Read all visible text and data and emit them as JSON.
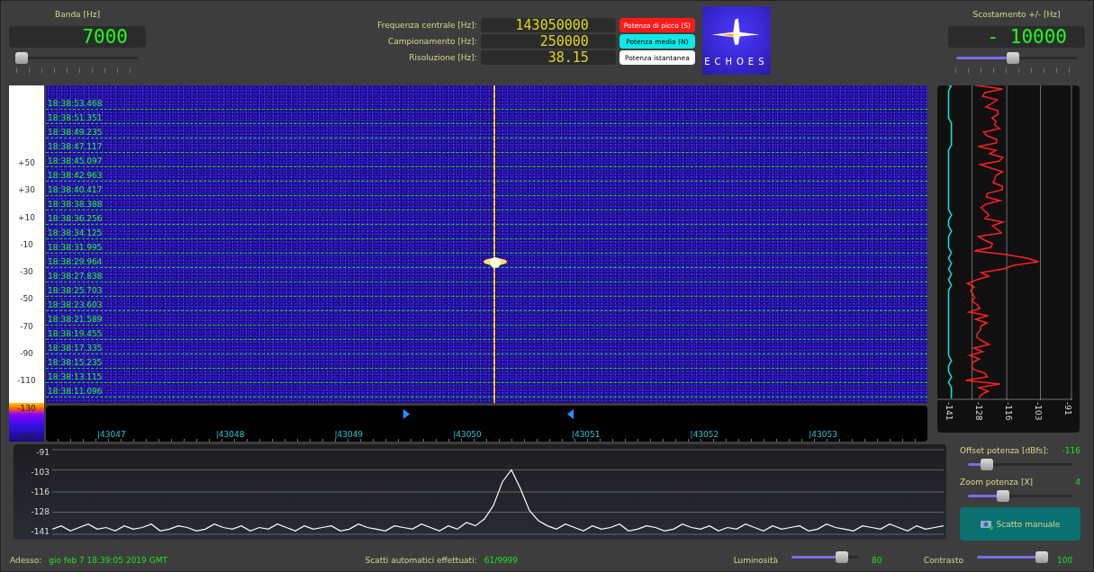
{
  "band": {
    "label": "Banda [Hz]",
    "value": "7000",
    "level": 0.04
  },
  "center": {
    "rows": [
      {
        "label": "Frequenza centrale [Hz]:",
        "value": "143050000"
      },
      {
        "label": "Campionamento [Hz]:",
        "value": "250000"
      },
      {
        "label": "Risoluzione [Hz]:",
        "value": "38.15"
      }
    ],
    "power_buttons": [
      {
        "label": "Potenza di picco (S)",
        "color": "#ff1a1a"
      },
      {
        "label": "Potenza media (N)",
        "color": "#10e8e8"
      },
      {
        "label": "Potenza istantanea",
        "color": "#ffffff"
      }
    ],
    "logo": {
      "text": "ECHOES"
    }
  },
  "offset": {
    "label": "Scostamento +/- [Hz]",
    "value": "- 10000",
    "level": 0.47
  },
  "color_scale": {
    "labels": [
      "+50",
      "+30",
      "+10",
      "-10",
      "-30",
      "-50",
      "-70",
      "-90",
      "-110"
    ],
    "low_labels": [
      "-130",
      "-150"
    ]
  },
  "waterfall": {
    "timestamps": [
      "18:38:53.468",
      "18:38:51.351",
      "18:38:49.235",
      "18:38:47.117",
      "18:38:45.097",
      "18:38:42.963",
      "18:38:40.417",
      "18:38:38.388",
      "18:38:36.256",
      "18:38:34.125",
      "18:38:31.995",
      "18:38:29.964",
      "18:38:27.838",
      "18:38:25.703",
      "18:38:23.603",
      "18:38:21.589",
      "18:38:19.455",
      "18:38:17.335",
      "18:38:15.235",
      "18:38:13.115",
      "18:38:11.096"
    ]
  },
  "freq_axis": {
    "labels": [
      "|43047",
      "|43048",
      "|43049",
      "|43050",
      "|43051",
      "|43052",
      "|43053"
    ]
  },
  "power_panel": {
    "ticks": [
      "-141",
      "-128",
      "-116",
      "-103",
      "-91"
    ]
  },
  "spectrum": {
    "chart_data": {
      "type": "line",
      "ylim": [
        -141,
        -91
      ],
      "grid": true,
      "yticks": [
        {
          "value": -91,
          "label": "-91"
        },
        {
          "value": -103,
          "label": "-103"
        },
        {
          "value": -116,
          "label": "-116"
        },
        {
          "value": -128,
          "label": "-128"
        },
        {
          "value": -141,
          "label": "-141"
        }
      ],
      "series": [
        {
          "color": "#ffffff",
          "values": [
            -138,
            -136,
            -139,
            -137,
            -135,
            -138,
            -137,
            -139,
            -136,
            -138,
            -137,
            -135,
            -139,
            -138,
            -136,
            -137,
            -139,
            -138,
            -135,
            -137,
            -138,
            -136,
            -139,
            -137,
            -138,
            -135,
            -137,
            -139,
            -136,
            -138,
            -137,
            -136,
            -139,
            -138,
            -135,
            -137,
            -138,
            -139,
            -136,
            -137,
            -138,
            -135,
            -137,
            -139,
            -136,
            -138,
            -134,
            -136,
            -132,
            -124,
            -110,
            -103,
            -114,
            -127,
            -133,
            -136,
            -138,
            -135,
            -137,
            -139,
            -136,
            -138,
            -137,
            -135,
            -139,
            -138,
            -136,
            -137,
            -139,
            -138,
            -135,
            -137,
            -138,
            -136,
            -139,
            -137,
            -138,
            -135,
            -137,
            -139,
            -136,
            -138,
            -137,
            -136,
            -139,
            -138,
            -135,
            -137,
            -138,
            -139,
            -136,
            -137,
            -138,
            -135,
            -137,
            -139,
            -136,
            -138,
            -137,
            -136
          ]
        }
      ]
    }
  },
  "controls": {
    "sliders": [
      {
        "label": "Offset potenza [dBfs]:",
        "value": "-116",
        "level": 0.18
      },
      {
        "label": "Zoom potenza [X]",
        "value": "4",
        "level": 0.34
      }
    ],
    "button": "Scatto manuale"
  },
  "status_bar": {
    "now_label": "Adesso:",
    "now_value": "gio feb 7 18:39:05 2019 GMT",
    "shots_label": "Scatti automatici effettuati:",
    "shots_value": "61/9999",
    "sliders": [
      {
        "label": "Luminosità",
        "value": "80",
        "level": 0.75
      },
      {
        "label": "Contrasto",
        "value": "100",
        "level": 0.97
      }
    ]
  }
}
